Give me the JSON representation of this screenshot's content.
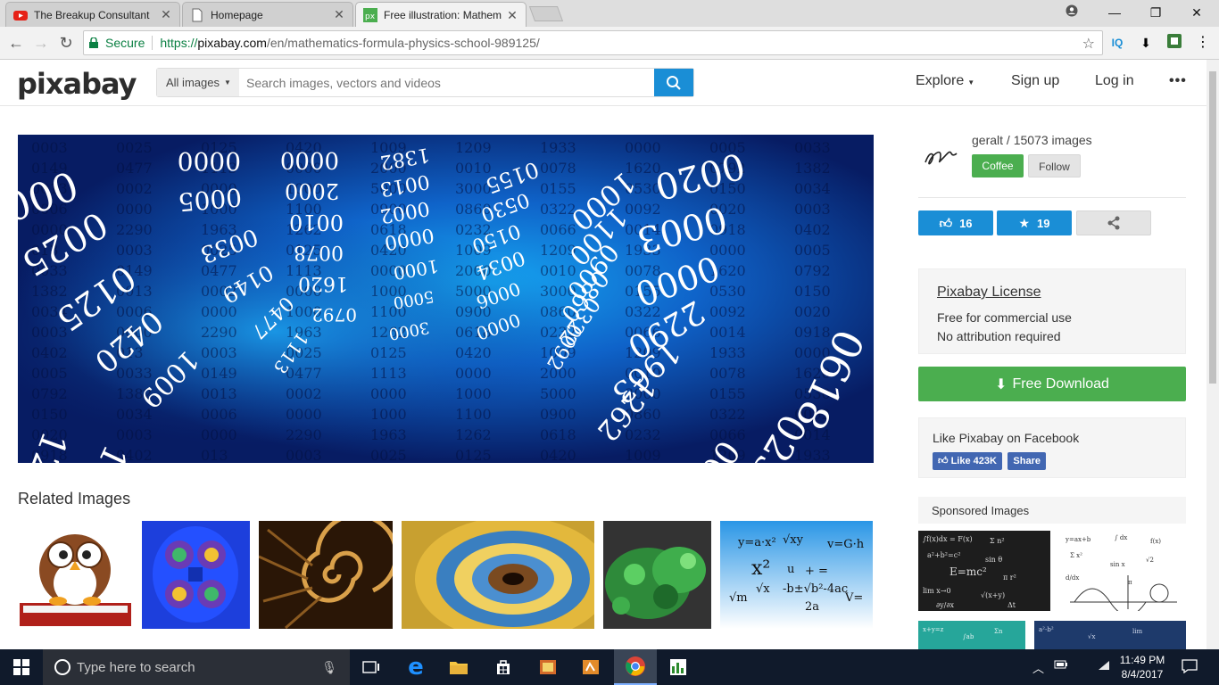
{
  "browser": {
    "tabs": [
      {
        "title": "The Breakup Consultant",
        "icon": "youtube-icon",
        "active": false
      },
      {
        "title": "Homepage",
        "icon": "page-icon",
        "active": false
      },
      {
        "title": "Free illustration: Mathem",
        "icon": "pixabay-icon",
        "active": true
      }
    ],
    "secure_label": "Secure",
    "url_scheme": "https://",
    "url_host": "pixabay.com",
    "url_path": "/en/mathematics-formula-physics-school-989125/"
  },
  "site": {
    "logo": "pixabay",
    "search_filter": "All images",
    "search_placeholder": "Search images, vectors and videos",
    "nav": {
      "explore": "Explore",
      "signup": "Sign up",
      "login": "Log in"
    }
  },
  "hero": {
    "numbers": [
      "0003",
      "0025",
      "0125",
      "0420",
      "1009",
      "1209",
      "1933",
      "0000",
      "0005",
      "0033",
      "0149",
      "0477",
      "1113",
      "0000",
      "2000",
      "0010",
      "0078",
      "1620",
      "0792",
      "1382",
      "0013",
      "0002",
      "0000",
      "1000",
      "5000",
      "3000",
      "0155",
      "0530",
      "0150",
      "0034",
      "0006",
      "0000",
      "1000",
      "1100",
      "0900",
      "0860",
      "0322",
      "0092",
      "0020",
      "0003",
      "0000",
      "2290",
      "1963",
      "1262",
      "0618",
      "0232",
      "0066",
      "0014",
      "0918",
      "0402",
      "013"
    ]
  },
  "related": {
    "title": "Related Images",
    "images": [
      "owl-on-book",
      "fractal-blue",
      "spiral-gold",
      "fractal-spiral",
      "fractal-green",
      "math-formulas-blue"
    ]
  },
  "author": {
    "name": "geralt / 15073 images",
    "avatar_text": "geralt",
    "coffee_label": "Coffee",
    "follow_label": "Follow"
  },
  "stats": {
    "likes": "16",
    "favorites": "19"
  },
  "license": {
    "title": "Pixabay License",
    "line1": "Free for commercial use",
    "line2": "No attribution required"
  },
  "download_label": "Free Download",
  "facebook": {
    "text": "Like Pixabay on Facebook",
    "like_label": "Like 423K",
    "share_label": "Share"
  },
  "sponsored_title": "Sponsored Images",
  "taskbar": {
    "search_placeholder": "Type here to search",
    "time": "11:49 PM",
    "date": "8/4/2017"
  },
  "colors": {
    "accent_blue": "#1a8ed6",
    "green": "#4bae4f",
    "facebook": "#4267b2",
    "taskbar": "#101a2b"
  }
}
